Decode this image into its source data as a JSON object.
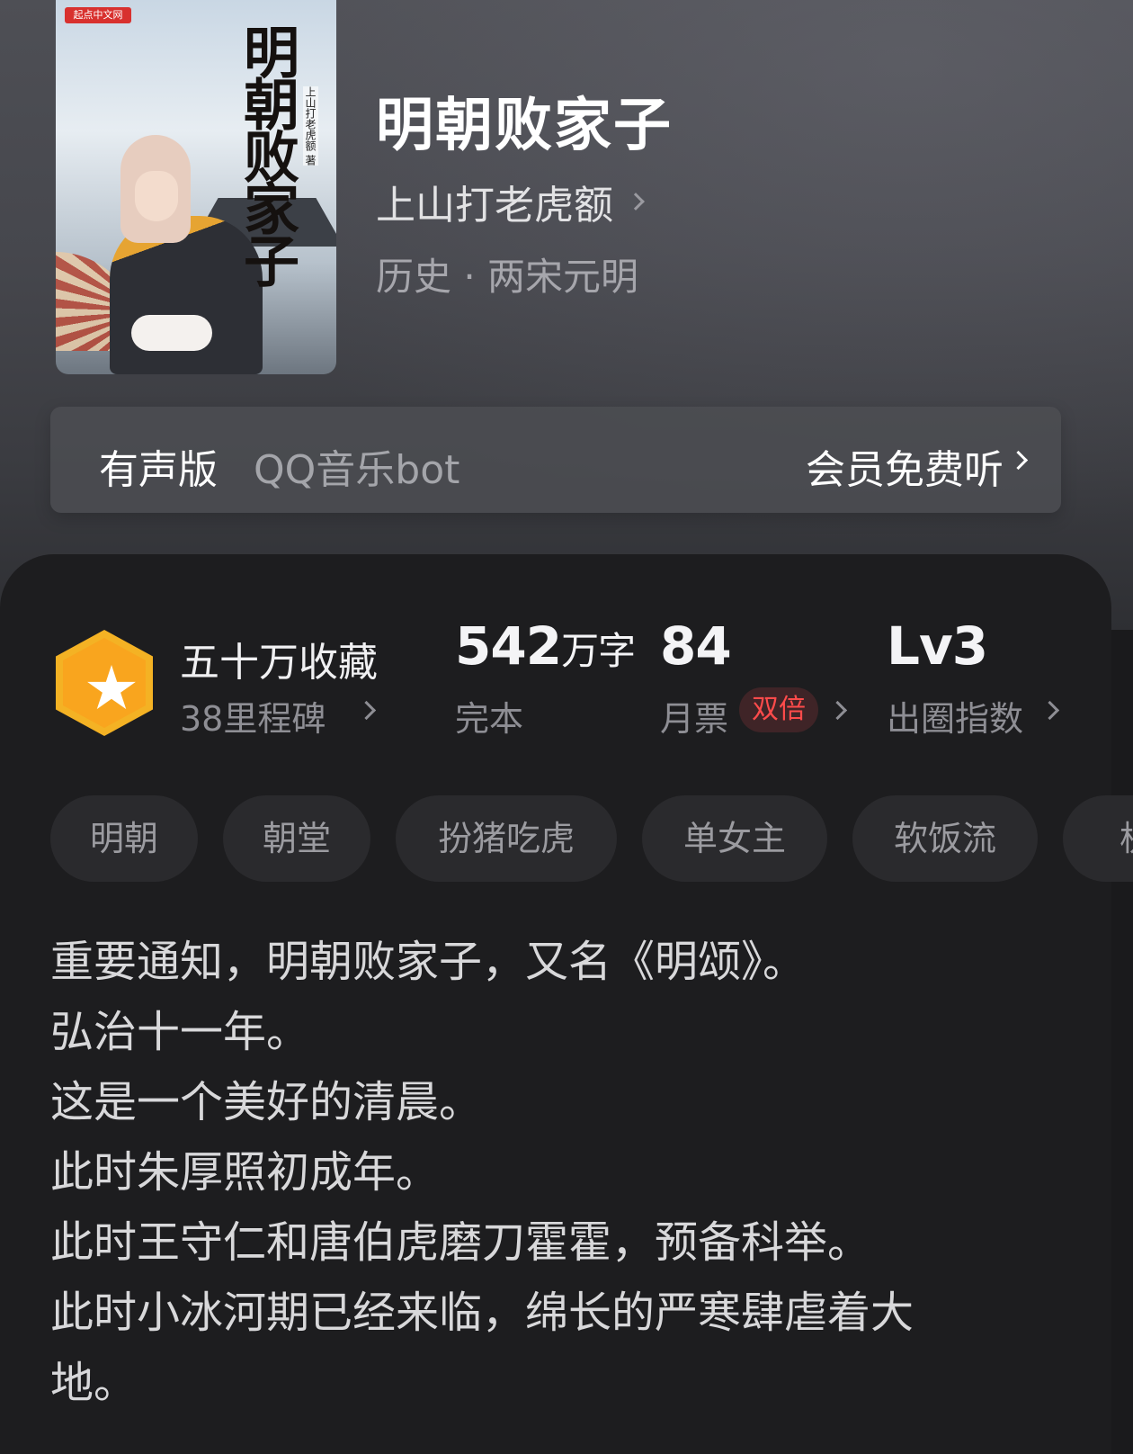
{
  "book": {
    "cover_publisher_badge": "起点中文网",
    "cover_title": "明朝败家子",
    "cover_author": "上山打老虎额 著",
    "title": "明朝败家子",
    "author": "上山打老虎额",
    "genre": "历史 · 两宋元明"
  },
  "audio": {
    "label": "有声版",
    "source": "QQ音乐bot",
    "action": "会员免费听"
  },
  "stats": {
    "badge_icon": "star-hexagon-icon",
    "collections": "五十万收藏",
    "milestones": "38里程碑",
    "word_count_num": "542",
    "word_count_unit": "万字",
    "status": "完本",
    "monthly_tickets": "84",
    "monthly_label": "月票",
    "double_badge": "双倍",
    "level": "Lv3",
    "level_label": "出圈指数"
  },
  "tags": [
    "明朝",
    "朝堂",
    "扮猪吃虎",
    "单女主",
    "软饭流",
    "杭"
  ],
  "description": [
    "重要通知，明朝败家子，又名《明颂》。",
    "弘治十一年。",
    "这是一个美好的清晨。",
    "此时朱厚照初成年。",
    "此时王守仁和唐伯虎磨刀霍霍，预备科举。",
    "此时小冰河期已经来临，绵长的严寒肆虐着大",
    "地。"
  ],
  "colors": {
    "accent_gold": "#f9a51e",
    "badge_red": "#ff4b4b",
    "panel_bg": "#1d1d1f"
  }
}
